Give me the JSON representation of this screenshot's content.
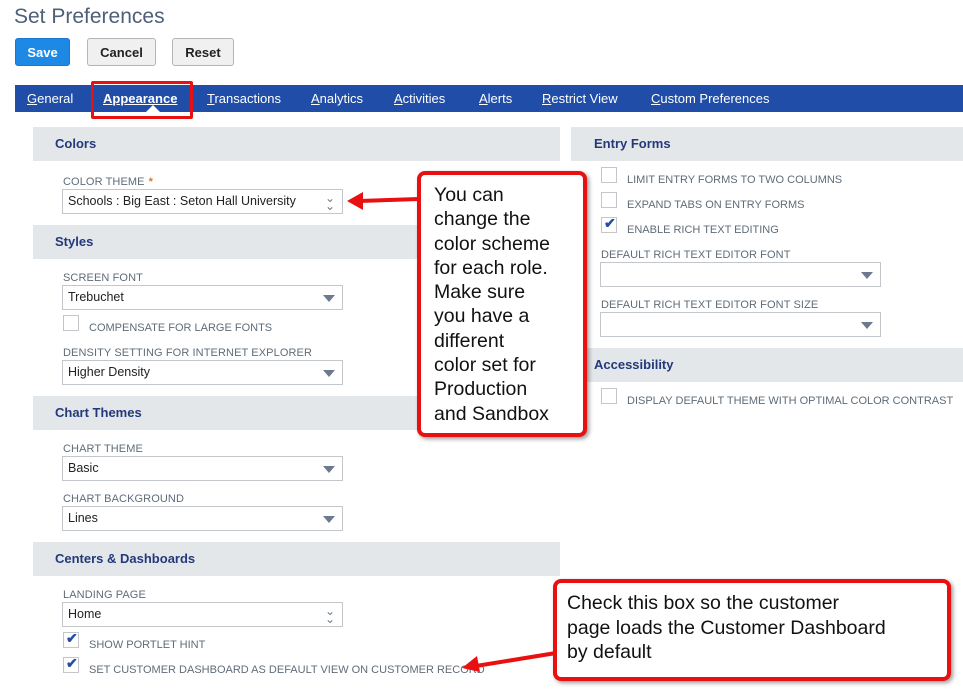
{
  "page": {
    "title": "Set Preferences"
  },
  "toolbar": {
    "save_label": "Save",
    "cancel_label": "Cancel",
    "reset_label": "Reset"
  },
  "tabs": [
    {
      "label": "General"
    },
    {
      "label": "Appearance",
      "active": true
    },
    {
      "label": "Transactions"
    },
    {
      "label": "Analytics"
    },
    {
      "label": "Activities"
    },
    {
      "label": "Alerts"
    },
    {
      "label": "Restrict View"
    },
    {
      "label": "Custom Preferences"
    }
  ],
  "colors": {
    "header": "Colors",
    "color_theme_label": "COLOR THEME",
    "required_mark": "*",
    "color_theme_value": "Schools : Big East : Seton Hall University"
  },
  "styles": {
    "header": "Styles",
    "screen_font_label": "SCREEN FONT",
    "screen_font_value": "Trebuchet",
    "compensate_label": "COMPENSATE FOR LARGE FONTS",
    "compensate_checked": false,
    "density_label": "DENSITY SETTING FOR INTERNET EXPLORER",
    "density_value": "Higher Density"
  },
  "chart_themes": {
    "header": "Chart Themes",
    "chart_theme_label": "CHART THEME",
    "chart_theme_value": "Basic",
    "chart_background_label": "CHART BACKGROUND",
    "chart_background_value": "Lines"
  },
  "centers": {
    "header": "Centers & Dashboards",
    "landing_page_label": "LANDING PAGE",
    "landing_page_value": "Home",
    "portlet_hint_label": "SHOW PORTLET HINT",
    "portlet_hint_checked": true,
    "customer_dashboard_label": "SET CUSTOMER DASHBOARD AS DEFAULT VIEW ON CUSTOMER RECORD",
    "customer_dashboard_checked": true
  },
  "entry_forms": {
    "header": "Entry Forms",
    "limit_two_columns_label": "LIMIT ENTRY FORMS TO TWO COLUMNS",
    "limit_two_columns_checked": false,
    "expand_tabs_label": "EXPAND TABS ON ENTRY FORMS",
    "expand_tabs_checked": false,
    "rich_text_label": "ENABLE RICH TEXT EDITING",
    "rich_text_checked": true,
    "editor_font_label": "DEFAULT RICH TEXT EDITOR FONT",
    "editor_font_value": "",
    "editor_font_size_label": "DEFAULT RICH TEXT EDITOR FONT SIZE",
    "editor_font_size_value": ""
  },
  "accessibility": {
    "header": "Accessibility",
    "contrast_label": "DISPLAY DEFAULT THEME WITH OPTIMAL COLOR CONTRAST",
    "contrast_checked": false
  },
  "callouts": {
    "color_scheme_lines": [
      "You can",
      "change the",
      "color scheme",
      "for each role.",
      "Make sure",
      "you have a",
      "different",
      "color set for",
      "Production",
      "and Sandbox"
    ],
    "dashboard_lines": [
      "Check this box so the customer",
      "page loads the Customer Dashboard",
      "by default"
    ]
  },
  "theme_colors": {
    "tab_bar": "#1f4da8",
    "primary_button": "#1e88e5",
    "annotation_red": "#e81010",
    "section_header_bg": "#e4e7ea"
  },
  "icons": {
    "select_caret": "caret-down-icon",
    "double_caret": "double-chevron-down-icon",
    "checkmark": "checkmark-icon",
    "arrow": "arrow-left-icon"
  }
}
